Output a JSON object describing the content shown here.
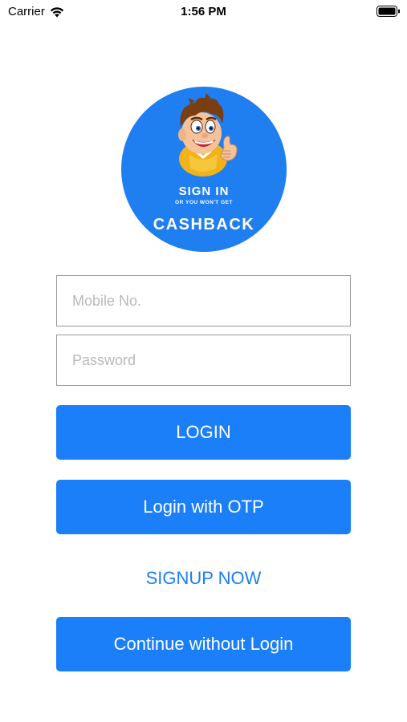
{
  "status_bar": {
    "carrier": "Carrier",
    "time": "1:56 PM"
  },
  "logo": {
    "line1": "SIGN IN",
    "line2": "OR YOU WON'T GET",
    "line3": "CASHBACK",
    "background": "#1f7ff0"
  },
  "form": {
    "mobile_placeholder": "Mobile No.",
    "mobile_value": "",
    "password_placeholder": "Password",
    "password_value": ""
  },
  "buttons": {
    "login": "LOGIN",
    "otp": "Login with OTP",
    "signup": "SIGNUP NOW",
    "continue": "Continue without Login"
  },
  "colors": {
    "accent": "#1a7ff8",
    "placeholder": "#b9b9bd",
    "field_border": "#9b9b9b"
  }
}
